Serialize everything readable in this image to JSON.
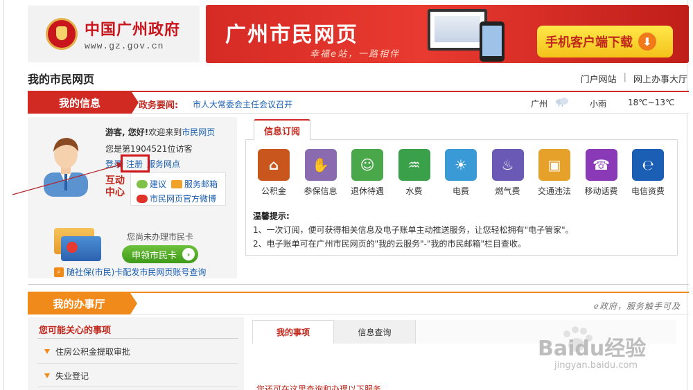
{
  "header": {
    "logo_cn": "中国广州政府",
    "logo_url": "www.gz.gov.cn",
    "banner_title": "广州市民网页",
    "banner_slogan": "幸福e站，一路相伴",
    "download_label": "手机客户端下载"
  },
  "page_title": "我的市民网页",
  "top_links": [
    "门户网站",
    "网上办事大厅"
  ],
  "info_bar": {
    "tab_label": "我的信息",
    "news_label": "政务要闻:",
    "news_text": "市人大常委会主任会议召开",
    "weather_city": "广州",
    "weather_condition": "小雨",
    "weather_temp": "18℃~13℃"
  },
  "user_panel": {
    "greet_bold": "游客, 您好!",
    "greet_text": "欢迎来到",
    "greet_link": "市民网页",
    "visitor_text": "您是第1904521位访客",
    "login_label": "登录",
    "register_label": "注册",
    "service_points_label": "服务网点",
    "interact_label": "互动中心",
    "suggest_label": "建议",
    "mail_label": "服务邮箱",
    "weibo_label": "市民网页官方微博",
    "no_card_text": "您尚未办理市民卡",
    "apply_label": "申领市民卡",
    "card_query_label": "随社保(市民)卡配发市民网页账号查询"
  },
  "subscribe": {
    "tab_label": "信息订阅",
    "services": [
      {
        "label": "公积金",
        "icon": "house-icon",
        "color": "#c9561d"
      },
      {
        "label": "参保信息",
        "icon": "handshake-icon",
        "color": "#8a6bb0"
      },
      {
        "label": "退休待遇",
        "icon": "elder-icon",
        "color": "#4aa84a"
      },
      {
        "label": "水费",
        "icon": "faucet-icon",
        "color": "#3aa04a"
      },
      {
        "label": "电费",
        "icon": "bulb-icon",
        "color": "#3a9ad6"
      },
      {
        "label": "燃气费",
        "icon": "flame-icon",
        "color": "#6a5ab6"
      },
      {
        "label": "交通违法",
        "icon": "car-icon",
        "color": "#e6a12a"
      },
      {
        "label": "移动话费",
        "icon": "mobile-icon",
        "color": "#8a3ab6"
      },
      {
        "label": "电信资费",
        "icon": "telecom-icon",
        "color": "#1a5fb4"
      }
    ],
    "tips_title": "温馨提示:",
    "tips": [
      "1、一次订阅，便可获得相关信息及电子账单主动推送服务，让您轻松拥有\"电子管家\"。",
      "2、电子账单可在广州市民网页的\"我的云服务\"-\"我的市民邮箱\"栏目查收。"
    ]
  },
  "hall": {
    "tab_label": "我的办事厅",
    "slogan": "e政府，服务触手可及",
    "concern_title": "您可能关心的事项",
    "concern_items": [
      "住房公积金提取审批",
      "失业登记"
    ],
    "tabs": [
      "我的事项",
      "信息查询"
    ],
    "partial_text": "您还可在这里查询和办理以下服务"
  },
  "watermark": {
    "text": "Baidu经验",
    "sub": "jingyan.baidu.com"
  }
}
